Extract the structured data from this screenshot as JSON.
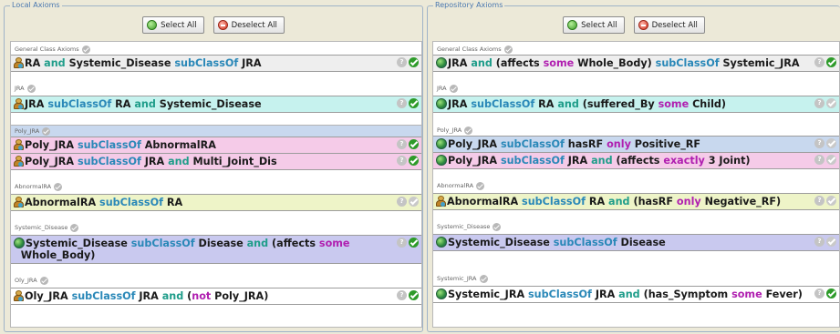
{
  "left": {
    "title": "Local Axioms",
    "select_all": "Select All",
    "deselect_all": "Deselect All",
    "sections": [
      {
        "name": "General Class Axioms",
        "axioms": [
          {
            "text": "RA and Systemic_Disease subClassOf JRA",
            "color": "gray",
            "icon": "person-icon"
          }
        ]
      },
      {
        "name": "JRA",
        "axioms": [
          {
            "text": "JRA subClassOf RA and Systemic_Disease",
            "color": "cyan",
            "icon": "person-icon"
          }
        ]
      },
      {
        "name": "Poly_JRA",
        "axioms": [
          {
            "text": "Poly_JRA subClassOf AbnormalRA",
            "color": "pink",
            "icon": "person-icon"
          },
          {
            "text": "Poly_JRA subClassOf JRA and Multi_Joint_Dis",
            "color": "pink",
            "icon": "person-icon"
          }
        ]
      },
      {
        "name": "AbnormalRA",
        "axioms": [
          {
            "text": "AbnormalRA subClassOf RA",
            "color": "yellow",
            "icon": "person-icon"
          }
        ]
      },
      {
        "name": "Systemic_Disease",
        "axioms": [
          {
            "text": "Systemic_Disease subClassOf Disease and (affects some Whole_Body)",
            "color": "lavender",
            "icon": "globe-icon"
          }
        ]
      },
      {
        "name": "Oly_JRA",
        "axioms": [
          {
            "text": "Oly_JRA subClassOf JRA and (not Poly_JRA)",
            "color": "white",
            "icon": "person-icon"
          }
        ]
      }
    ]
  },
  "right": {
    "title": "Repository Axioms",
    "select_all": "Select All",
    "deselect_all": "Deselect All",
    "sections": [
      {
        "name": "General Class Axioms",
        "axioms": [
          {
            "text": "JRA and (affects some Whole_Body) subClassOf Systemic_JRA",
            "color": "gray",
            "icon": "globe-icon"
          }
        ]
      },
      {
        "name": "JRA",
        "axioms": [
          {
            "text": "JRA subClassOf RA and (suffered_By some Child)",
            "color": "cyan",
            "icon": "globe-icon"
          }
        ]
      },
      {
        "name": "Poly_JRA",
        "axioms": [
          {
            "text": "Poly_JRA subClassOf hasRF only Positive_RF",
            "color": "blue",
            "icon": "globe-icon"
          },
          {
            "text": "Poly_JRA subClassOf JRA and (affects exactly 3 Joint)",
            "color": "pink",
            "icon": "globe-icon"
          }
        ]
      },
      {
        "name": "AbnormalRA",
        "axioms": [
          {
            "text": "AbnormalRA subClassOf RA and (hasRF only Negative_RF)",
            "color": "yellow",
            "icon": "person-icon"
          }
        ]
      },
      {
        "name": "Systemic_Disease",
        "axioms": [
          {
            "text": "Systemic_Disease subClassOf Disease",
            "color": "lavender",
            "icon": "globe-icon"
          }
        ]
      },
      {
        "name": "Systemic_JRA",
        "axioms": [
          {
            "text": "Systemic_JRA subClassOf JRA and (has_Symptom some Fever)",
            "color": "white",
            "icon": "globe-icon"
          }
        ]
      }
    ]
  }
}
